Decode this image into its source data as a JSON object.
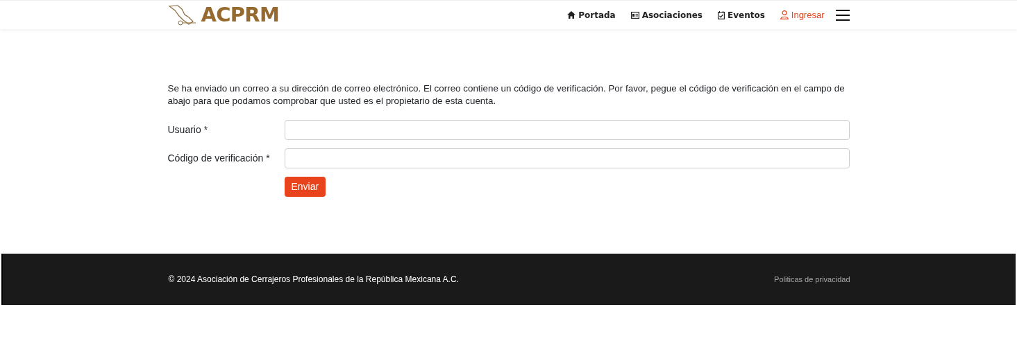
{
  "header": {
    "logo": "ACPRM",
    "nav": [
      {
        "label": "Portada",
        "kind": "home"
      },
      {
        "label": "Asociaciones",
        "kind": "card"
      },
      {
        "label": "Eventos",
        "kind": "calendar"
      },
      {
        "label": "Ingresar",
        "kind": "user"
      }
    ]
  },
  "message": "Se ha enviado un correo a su dirección de correo electrónico. El correo contiene un código de verificación. Por favor, pegue el código de verificación en el campo de abajo para que podamos comprobar que usted es el propietario de esta cuenta.",
  "fields": [
    {
      "label": "Usuario *"
    },
    {
      "label": "Código de verificación *"
    }
  ],
  "submit": "Enviar",
  "footer": {
    "copyright": "© 2024 Asociación de Cerrajeros Profesionales de la República Mexicana A.C.",
    "link": "Politicas de privacidad"
  }
}
